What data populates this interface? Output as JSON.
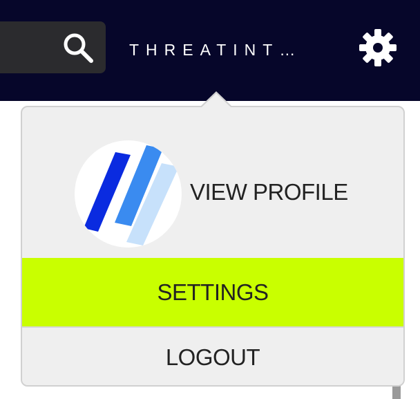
{
  "header": {
    "brand_text": "THREATINT…",
    "search_icon": "search-icon",
    "settings_icon": "gear-icon",
    "background_color": "#06062a"
  },
  "user_menu": {
    "view_profile_label": "VIEW PROFILE",
    "settings_label": "SETTINGS",
    "logout_label": "LOGOUT",
    "active_item": "SETTINGS",
    "highlight_color": "#c9ff00",
    "avatar_icon": "avatar-logo"
  }
}
